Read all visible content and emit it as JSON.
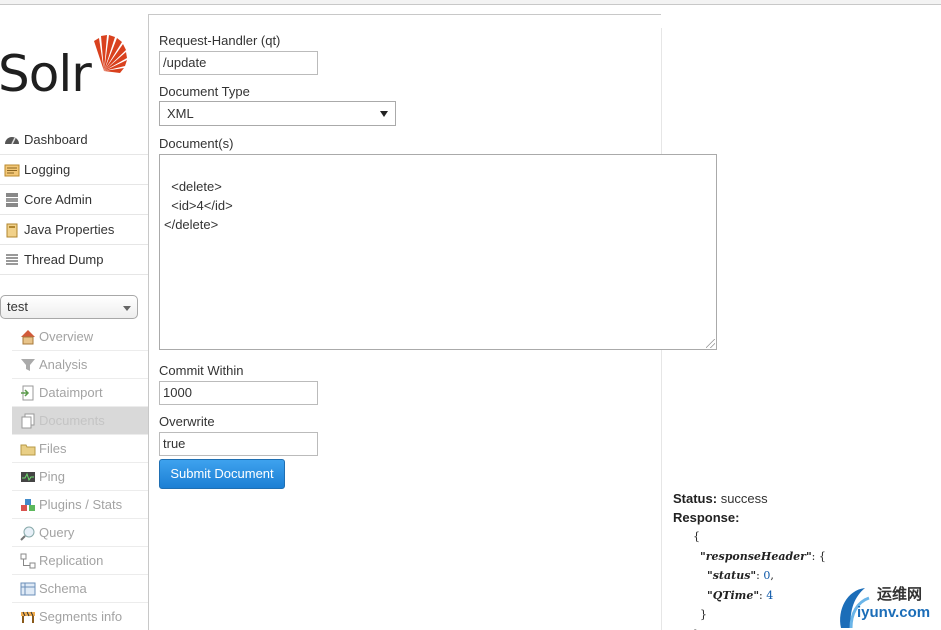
{
  "logo": {
    "text": "Solr"
  },
  "main_nav": [
    {
      "label": "Dashboard",
      "icon": "dashboard-icon"
    },
    {
      "label": "Logging",
      "icon": "logging-icon"
    },
    {
      "label": "Core Admin",
      "icon": "core-admin-icon"
    },
    {
      "label": "Java Properties",
      "icon": "java-properties-icon"
    },
    {
      "label": "Thread Dump",
      "icon": "thread-dump-icon"
    }
  ],
  "core_selector": {
    "value": "test"
  },
  "core_nav": [
    {
      "label": "Overview",
      "icon": "home-icon"
    },
    {
      "label": "Analysis",
      "icon": "funnel-icon"
    },
    {
      "label": "Dataimport",
      "icon": "dataimport-icon"
    },
    {
      "label": "Documents",
      "icon": "documents-icon",
      "active": true
    },
    {
      "label": "Files",
      "icon": "folder-icon"
    },
    {
      "label": "Ping",
      "icon": "ping-icon"
    },
    {
      "label": "Plugins / Stats",
      "icon": "plugins-icon"
    },
    {
      "label": "Query",
      "icon": "magnifier-icon"
    },
    {
      "label": "Replication",
      "icon": "replication-icon"
    },
    {
      "label": "Schema",
      "icon": "schema-icon"
    },
    {
      "label": "Segments info",
      "icon": "segments-icon"
    }
  ],
  "form": {
    "handler_label": "Request-Handler (qt)",
    "handler_value": "/update",
    "doctype_label": "Document Type",
    "doctype_value": "XML",
    "documents_label": "Document(s)",
    "documents_value": "<delete>\n  <id>4</id>\n</delete>",
    "commit_label": "Commit Within",
    "commit_value": "1000",
    "overwrite_label": "Overwrite",
    "overwrite_value": "true",
    "submit_label": "Submit Document"
  },
  "response": {
    "status_label": "Status:",
    "status_value": "success",
    "response_label": "Response:",
    "json": {
      "open": "{",
      "header_key": "\"responseHeader\"",
      "header_open": ": {",
      "status_key": "\"status\"",
      "status_value": "0",
      "qtime_key": "\"QTime\"",
      "qtime_value": "4",
      "header_close": "}",
      "close": "}"
    }
  },
  "watermark": {
    "cn": "运维网",
    "en": "iyunv.com"
  },
  "colors": {
    "accent_blue": "#1c7fd4",
    "solr_red": "#d9411e"
  }
}
